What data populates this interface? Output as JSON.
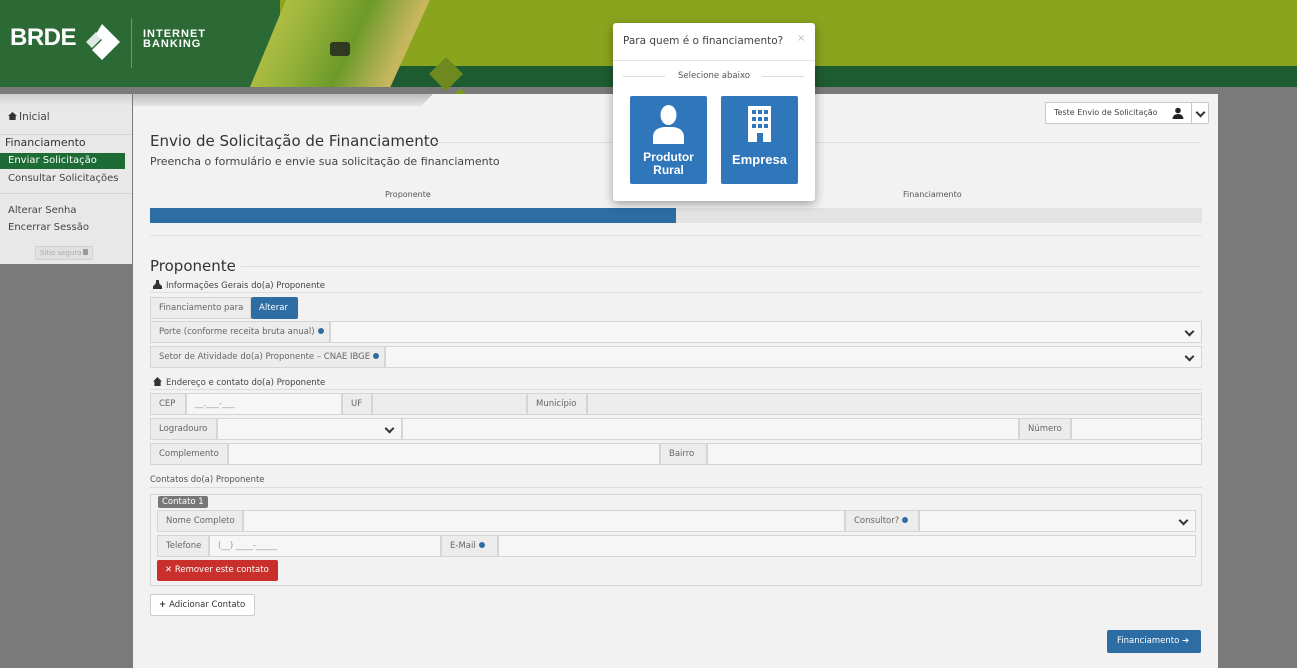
{
  "header": {
    "logo_text": "BRDE",
    "internet_banking_line1": "INTERNET",
    "internet_banking_line2": "BANKING"
  },
  "sidebar": {
    "home": "Inicial",
    "section": "Financiamento",
    "items": [
      {
        "label": "Enviar Solicitação",
        "active": true
      },
      {
        "label": "Consultar Solicitações",
        "active": false
      },
      {
        "label": "Alterar Senha",
        "active": false
      },
      {
        "label": "Encerrar Sessão",
        "active": false
      }
    ],
    "secure_badge": "Sitio seguro"
  },
  "user_menu": {
    "name": "Teste Envio de Solicitação"
  },
  "page": {
    "title": "Envio de Solicitação de Financiamento",
    "subtitle": "Preencha o formulário e envie sua solicitação de financiamento"
  },
  "steps": {
    "labels": [
      "Proponente",
      "Financiamento"
    ],
    "progress_fraction": 0.5
  },
  "proponente": {
    "title": "Proponente",
    "general_heading": "Informações Gerais do(a) Proponente",
    "financing_for_label": "Financiamento para",
    "alter_button": "Alterar",
    "porte_label": "Porte (conforme receita bruta anual)",
    "setor_label": "Setor de Atividade do(a) Proponente – CNAE IBGE",
    "address_heading": "Endereço e contato do(a) Proponente",
    "cep_label": "CEP",
    "cep_placeholder": "__.___-___",
    "uf_label": "UF",
    "municipio_label": "Município",
    "logradouro_label": "Logradouro",
    "numero_label": "Número",
    "complemento_label": "Complemento",
    "bairro_label": "Bairro",
    "contacts_heading": "Contatos do(a) Proponente",
    "contact_tag": "Contato 1",
    "nome_label": "Nome Completo",
    "consultor_label": "Consultor?",
    "telefone_label": "Telefone",
    "telefone_placeholder": "(__) ____-_____",
    "email_label": "E-Mail",
    "remove_button": "Remover este contato",
    "add_button": "Adicionar Contato",
    "next_button": "Financiamento"
  },
  "modal": {
    "title": "Para quem é o financiamento?",
    "close": "×",
    "hint": "Selecione abaixo",
    "options": [
      {
        "line1": "Produtor",
        "line2": "Rural",
        "icon": "person-icon"
      },
      {
        "line1": "Empresa",
        "line2": "",
        "icon": "building-icon"
      }
    ]
  },
  "colors": {
    "brand_green": "#1d6b35",
    "header_olive": "#8aa41e",
    "primary_blue": "#2d6da3",
    "danger_red": "#c9302c"
  }
}
